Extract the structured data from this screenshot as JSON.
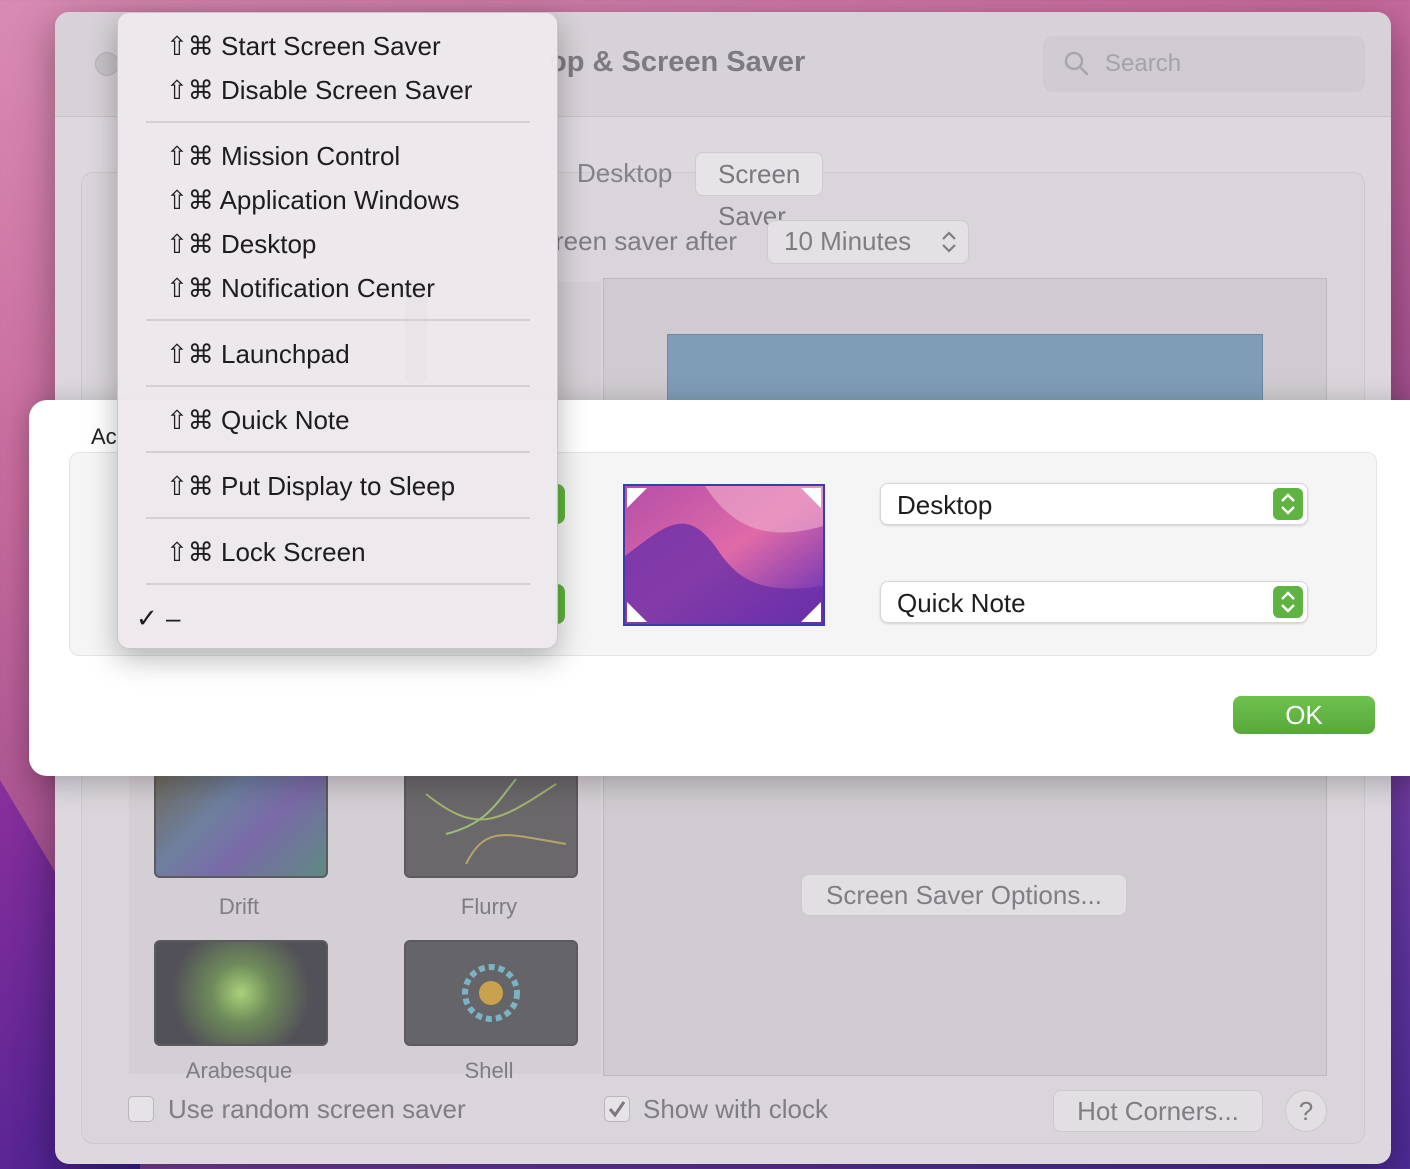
{
  "window": {
    "title": "op & Screen Saver",
    "search_placeholder": "Search",
    "tabs": [
      "Desktop",
      "Screen Saver"
    ],
    "saver_after_label": "reen saver after",
    "saver_after_value": "10 Minutes",
    "screen_savers": [
      {
        "label": "Drift"
      },
      {
        "label": "Flurry"
      },
      {
        "label": "Arabesque"
      },
      {
        "label": "Shell"
      }
    ],
    "options_button": "Screen Saver Options...",
    "random_label": "Use random screen saver",
    "random_checked": false,
    "clock_label": "Show with clock",
    "clock_checked": true,
    "hot_corners_button": "Hot Corners...",
    "help_button": "?"
  },
  "sheet": {
    "heading_partial": "Ac",
    "top_right_value": "Desktop",
    "bottom_right_value": "Quick Note",
    "ok_button": "OK"
  },
  "menu": {
    "groups": [
      [
        "⇧⌘ Start Screen Saver",
        "⇧⌘ Disable Screen Saver"
      ],
      [
        "⇧⌘ Mission Control",
        "⇧⌘ Application Windows",
        "⇧⌘ Desktop",
        "⇧⌘ Notification Center"
      ],
      [
        "⇧⌘ Launchpad"
      ],
      [
        "⇧⌘ Quick Note"
      ],
      [
        "⇧⌘ Put Display to Sleep"
      ],
      [
        "⇧⌘ Lock Screen"
      ]
    ],
    "selected_item": "–",
    "check_mark": "✓"
  },
  "colors": {
    "accent_green": "#5fb340",
    "menu_bg": "#ece8ec"
  }
}
